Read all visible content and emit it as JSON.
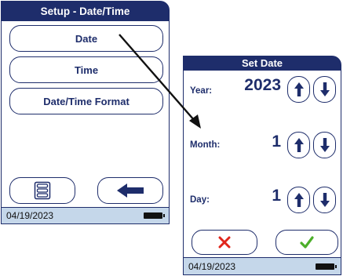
{
  "setup_screen": {
    "title": "Setup - Date/Time",
    "menu": [
      "Date",
      "Time",
      "Date/Time Format"
    ],
    "footer_date": "04/19/2023"
  },
  "set_date_screen": {
    "title": "Set Date",
    "year_label": "Year:",
    "year_value": "2023",
    "month_label": "Month:",
    "month_value": "1",
    "day_label": "Day:",
    "day_value": "1",
    "footer_date": "04/19/2023"
  },
  "colors": {
    "navy": "#1e2d6b",
    "footer_bg": "#c5d7ea",
    "cancel_red": "#e0251b",
    "confirm_green": "#4caf2a"
  },
  "icons": [
    "menu-list-icon",
    "back-arrow-icon",
    "up-arrow-icon",
    "down-arrow-icon",
    "cancel-x-icon",
    "confirm-check-icon",
    "battery-icon"
  ]
}
